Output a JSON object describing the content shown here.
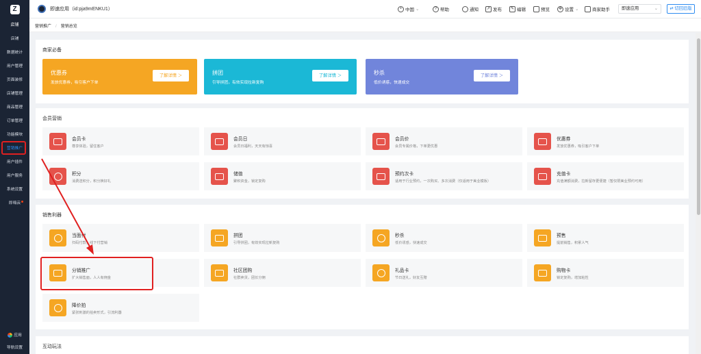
{
  "sidebar": {
    "logo": "Z",
    "top_item": "店铺",
    "items": [
      {
        "label": "店铺",
        "active": false
      },
      {
        "label": "数据统计",
        "active": false
      },
      {
        "label": "用户管理",
        "active": false
      },
      {
        "label": "页面装修",
        "active": false
      },
      {
        "label": "店铺管理",
        "active": false
      },
      {
        "label": "商品管理",
        "active": false
      },
      {
        "label": "订单管理",
        "active": false
      },
      {
        "label": "功能模块",
        "active": false
      },
      {
        "label": "营销推广",
        "active": true
      },
      {
        "label": "用户插件",
        "active": false
      },
      {
        "label": "用户服务",
        "active": false
      },
      {
        "label": "系统设置",
        "active": false
      },
      {
        "label": "即嗨云",
        "active": false,
        "dot": true
      }
    ],
    "bottom": {
      "apps": "应用",
      "settings": "导航设置"
    }
  },
  "header": {
    "app_title": "即速应用（id:pja9mENKU1）",
    "region": "中国",
    "help": "帮助",
    "notify": "通知",
    "publish": "发布",
    "edit": "编辑",
    "preview": "预览",
    "settings": "设置",
    "merchant_assistant": "商家助手",
    "app_select": "即速应用",
    "switch_version": "切回旧版"
  },
  "breadcrumb": [
    "营销推广",
    "营销总览"
  ],
  "sections": {
    "essentials": {
      "title": "商家必备",
      "promos": [
        {
          "title": "优惠券",
          "desc": "发放优惠券，吸引客户下单",
          "button": "了解详情 ＞",
          "color": "#f5a623"
        },
        {
          "title": "拼团",
          "desc": "引导拼团，有效实现拉新复购",
          "button": "了解详情 ＞",
          "color": "#1bb8d6"
        },
        {
          "title": "秒杀",
          "desc": "低价诱惑，快速成交",
          "button": "了解详情 ＞",
          "color": "#7185db"
        }
      ]
    },
    "member": {
      "title": "会员营销",
      "cards": [
        {
          "name": "会员卡",
          "desc": "尊享体验，留住客户",
          "icon": "credit-card-icon"
        },
        {
          "name": "会员日",
          "desc": "会员日福利，天天有惊喜",
          "icon": "vip-calendar-icon"
        },
        {
          "name": "会员价",
          "desc": "会员专属价格，下单更优惠",
          "icon": "diamond-icon"
        },
        {
          "name": "优惠券",
          "desc": "发放优惠券，吸引客户下单",
          "icon": "coupon-icon"
        },
        {
          "name": "积分",
          "desc": "消费送积分，积分换好礼",
          "icon": "points-icon"
        },
        {
          "name": "储值",
          "desc": "聚积资金，锁定复购",
          "icon": "wallet-icon"
        },
        {
          "name": "预约次卡",
          "desc": "适用于行业预约，一次购买、多次消费（仅适用于美业模板）",
          "icon": "time-card-icon"
        },
        {
          "name": "充值卡",
          "desc": "充值满额消费，拉新留存更便捷（暂仅限美业预约可用）",
          "icon": "recharge-card-icon"
        }
      ]
    },
    "sales": {
      "title": "销售利器",
      "cards": [
        {
          "name": "当面付",
          "desc": "扫码付款，线下付营销",
          "icon": "face-pay-icon"
        },
        {
          "name": "拼团",
          "desc": "引导拼团，有效实现拉新复购",
          "icon": "group-buy-icon"
        },
        {
          "name": "秒杀",
          "desc": "低价诱惑，快速成交",
          "icon": "alarm-clock-icon"
        },
        {
          "name": "预售",
          "desc": "提前销售，积累人气",
          "icon": "presale-icon"
        },
        {
          "name": "分销推广",
          "desc": "扩大销售面，人人有佣金",
          "icon": "distribution-icon"
        },
        {
          "name": "社区团购",
          "desc": "社群卖货，团长分佣",
          "icon": "community-tag-icon"
        },
        {
          "name": "礼品卡",
          "desc": "节日送礼，好友互赠",
          "icon": "gift-icon"
        },
        {
          "name": "购物卡",
          "desc": "锁定复购，增加粘性",
          "icon": "shopping-card-icon"
        },
        {
          "name": "降价拍",
          "desc": "紧张刺激的拍卖形式，引流利器",
          "icon": "price-drop-icon"
        }
      ]
    },
    "interactive": {
      "title": "互动玩法"
    }
  }
}
